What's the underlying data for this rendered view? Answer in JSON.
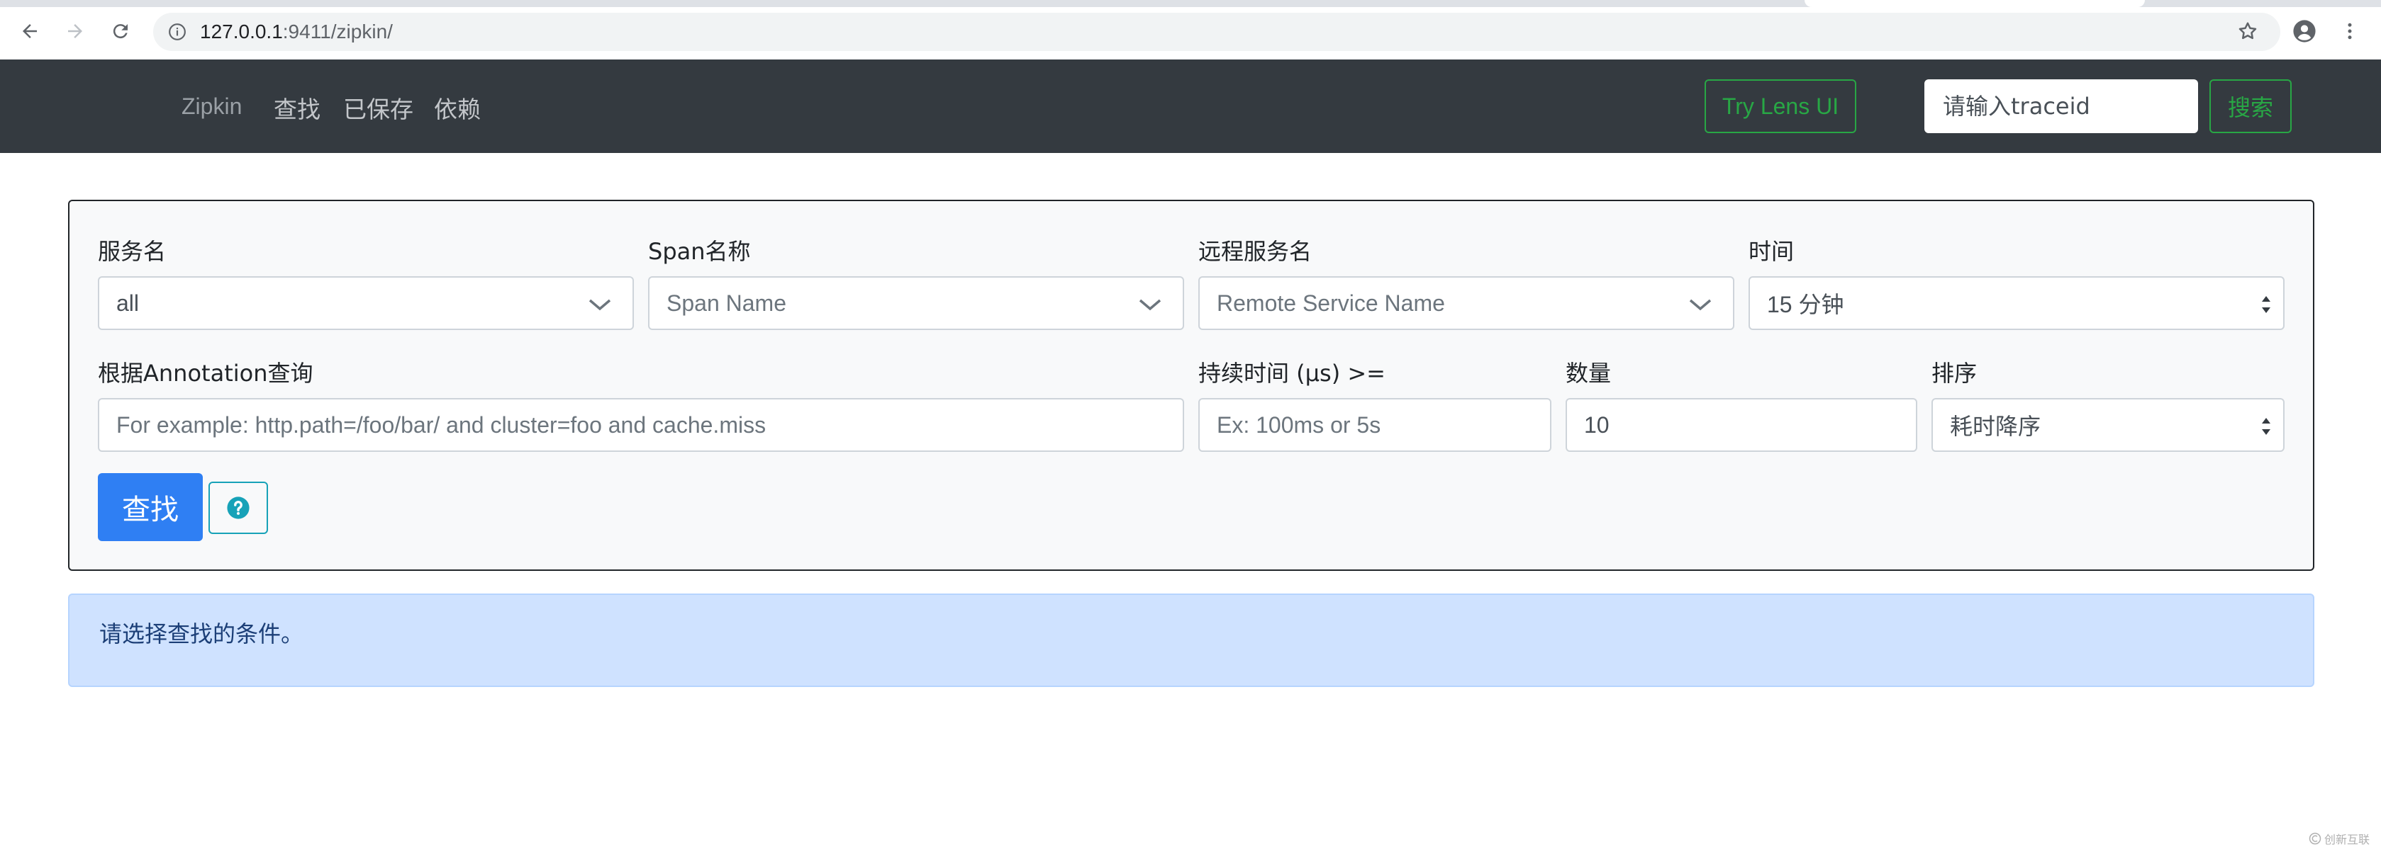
{
  "browser": {
    "url_host": "127.0.0.1",
    "url_rest": ":9411/zipkin/"
  },
  "navbar": {
    "brand": "Zipkin",
    "links": [
      "查找",
      "已保存",
      "依赖"
    ],
    "lens_button": "Try Lens UI",
    "traceid_placeholder": "请输入traceid",
    "search_button": "搜索",
    "accent_color": "#28a745",
    "background_color": "#343a40"
  },
  "form": {
    "service_label": "服务名",
    "service_value": "all",
    "span_label": "Span名称",
    "span_value": "Span Name",
    "remote_label": "远程服务名",
    "remote_value": "Remote Service Name",
    "time_label": "时间",
    "time_value": "15 分钟",
    "annotation_label": "根据Annotation查询",
    "annotation_placeholder": "For example: http.path=/foo/bar/ and cluster=foo and cache.miss",
    "duration_label": "持续时间 (μs) >=",
    "duration_placeholder": "Ex: 100ms or 5s",
    "limit_label": "数量",
    "limit_value": "10",
    "sort_label": "排序",
    "sort_value": "耗时降序",
    "find_button": "查找",
    "primary_color": "#2f7ff3"
  },
  "alert": {
    "message": "请选择查找的条件。"
  },
  "watermark": {
    "text": "创新互联"
  }
}
